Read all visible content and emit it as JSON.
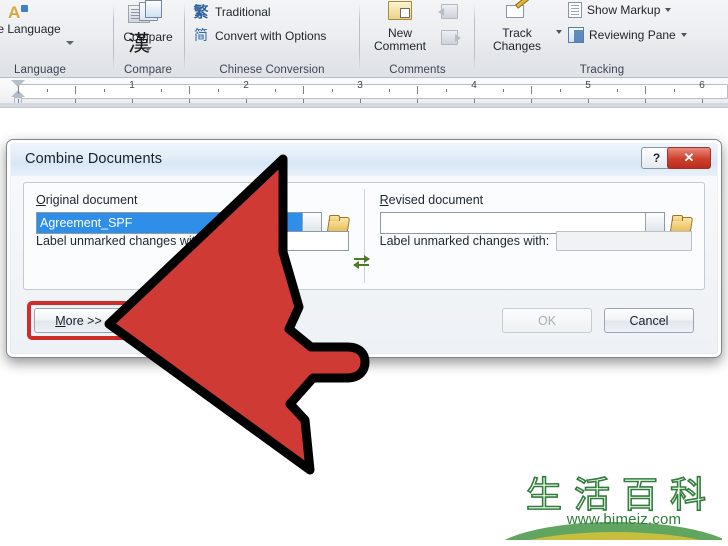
{
  "ribbon": {
    "groups": [
      {
        "name": "language",
        "label": "Language",
        "items": [
          {
            "label": "te Language",
            "icon": "language-icon"
          },
          {
            "label": "",
            "icon": "dictionary-icon"
          },
          {
            "label": "漢",
            "icon": "chinese-char-icon"
          }
        ]
      },
      {
        "name": "compare",
        "label": "Compare",
        "items": [
          {
            "label": "Compare",
            "icon": "compare-icon"
          }
        ]
      },
      {
        "name": "chinese-conversion",
        "label": "Chinese Conversion",
        "items": [
          {
            "label": "Traditional",
            "icon": "traditional-chinese-icon",
            "glyph": "繁"
          },
          {
            "label": "Convert with Options",
            "icon": "convert-options-icon",
            "glyph": "简"
          }
        ]
      },
      {
        "name": "comments",
        "label": "Comments",
        "items": [
          {
            "label": "New\nComment",
            "icon": "new-comment-icon"
          },
          {
            "label": "",
            "icon": "previous-comment-icon"
          },
          {
            "label": "",
            "icon": "next-comment-icon"
          }
        ]
      },
      {
        "name": "tracking",
        "label": "Tracking",
        "items": [
          {
            "label": "Track\nChanges",
            "icon": "track-changes-icon"
          },
          {
            "label": "Show Markup",
            "icon": "show-markup-icon"
          },
          {
            "label": "Reviewing Pane",
            "icon": "reviewing-pane-icon"
          }
        ]
      }
    ],
    "labels": {
      "language": "Language",
      "compare": "Compare",
      "compare_btn": "Compare",
      "chinese_conversion": "Chinese Conversion",
      "traditional": "Traditional",
      "convert_with_options": "Convert with Options",
      "comments": "Comments",
      "new_comment_l1": "New",
      "new_comment_l2": "Comment",
      "tracking": "Tracking",
      "track_changes_l1": "Track",
      "track_changes_l2": "Changes",
      "show_markup": "Show Markup",
      "reviewing_pane": "Reviewing Pane",
      "language_btn": "te Language",
      "chinese_char": "漢",
      "traditional_glyph": "繁",
      "simplified_glyph": "简"
    }
  },
  "ruler": {
    "numbers": [
      "1",
      "2",
      "3",
      "4",
      "5",
      "6"
    ]
  },
  "dialog": {
    "title": "Combine Documents",
    "help_button": "?",
    "close_button": "✕",
    "original": {
      "label_prefix": "O",
      "label_rest": "riginal document",
      "label_full": "Original document",
      "value": "Agreement_SPF",
      "label_unmarked": "Label unmarked changes with:",
      "label_unmarked_value": ""
    },
    "revised": {
      "label_prefix": "R",
      "label_rest": "evised document",
      "label_full": "Revised document",
      "value": "",
      "label_unmarked": "Label unmarked changes with:",
      "label_unmarked_value": ""
    },
    "buttons": {
      "more": "More >>",
      "more_underline": "M",
      "more_rest": "ore >>",
      "ok": "OK",
      "cancel": "Cancel"
    }
  },
  "annotation": {
    "arrow_color": "#cf2d2a",
    "arrow_outline": "#000000",
    "highlight_color": "#cf2d2a"
  },
  "watermark": {
    "chars": [
      "生",
      "活",
      "百",
      "科"
    ],
    "url": "www.bimeiz.com",
    "color": "#2f7d3a"
  }
}
